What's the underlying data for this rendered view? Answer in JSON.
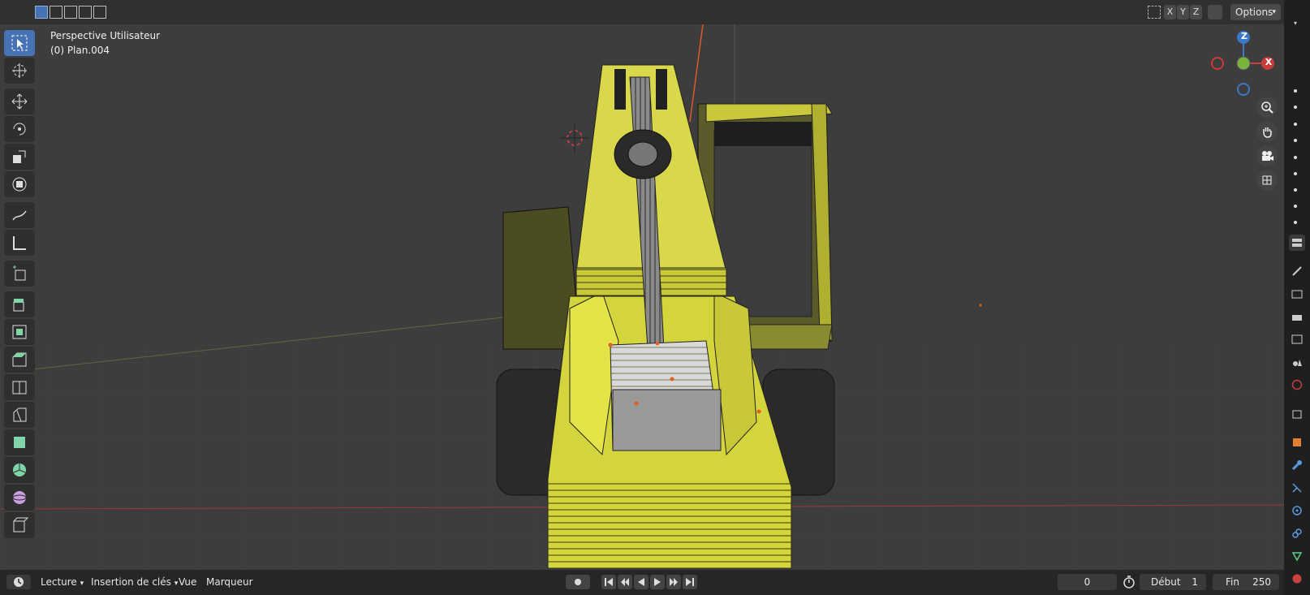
{
  "viewport": {
    "view_name": "Perspective Utilisateur",
    "object_label": "(0) Plan.004"
  },
  "header": {
    "axis_x": "X",
    "axis_y": "Y",
    "axis_z": "Z",
    "options_label": "Options"
  },
  "gizmo": {
    "z_label": "Z",
    "x_label": "X"
  },
  "timeline": {
    "menu_playback": "Lecture",
    "menu_keying": "Insertion de clés",
    "menu_view": "Vue",
    "menu_marker": "Marqueur",
    "current_frame": "0",
    "start_label": "Début",
    "start_value": "1",
    "end_label": "Fin",
    "end_value": "250"
  },
  "colors": {
    "accent": "#4772b3",
    "model_yellow": "#d8d84a",
    "axis_red": "#c83c3c",
    "axis_green": "#7ab33c",
    "axis_blue": "#3c78c8"
  }
}
